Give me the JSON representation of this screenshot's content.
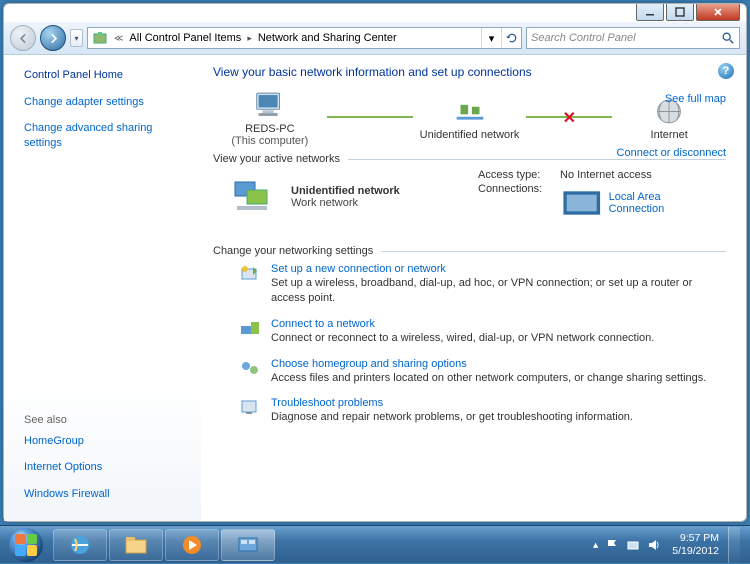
{
  "breadcrumb": {
    "prev": "All Control Panel Items",
    "current": "Network and Sharing Center"
  },
  "search": {
    "placeholder": "Search Control Panel"
  },
  "sidebar": {
    "home": "Control Panel Home",
    "links": [
      "Change adapter settings",
      "Change advanced sharing settings"
    ],
    "see_also_label": "See also",
    "see_also": [
      "HomeGroup",
      "Internet Options",
      "Windows Firewall"
    ]
  },
  "main": {
    "heading": "View your basic network information and set up connections",
    "full_map": "See full map",
    "nodes": {
      "pc": "REDS-PC",
      "pc_sub": "(This computer)",
      "net": "Unidentified network",
      "internet": "Internet"
    },
    "sect_active": "View your active networks",
    "connect_link": "Connect or disconnect",
    "netbox": {
      "name": "Unidentified network",
      "type": "Work network",
      "access_k": "Access type:",
      "access_v": "No Internet access",
      "conn_k": "Connections:",
      "conn_v": "Local Area Connection"
    },
    "sect_change": "Change your networking settings",
    "options": [
      {
        "title": "Set up a new connection or network",
        "desc": "Set up a wireless, broadband, dial-up, ad hoc, or VPN connection; or set up a router or access point."
      },
      {
        "title": "Connect to a network",
        "desc": "Connect or reconnect to a wireless, wired, dial-up, or VPN network connection."
      },
      {
        "title": "Choose homegroup and sharing options",
        "desc": "Access files and printers located on other network computers, or change sharing settings."
      },
      {
        "title": "Troubleshoot problems",
        "desc": "Diagnose and repair network problems, or get troubleshooting information."
      }
    ]
  },
  "clock": {
    "time": "9:57 PM",
    "date": "5/19/2012"
  }
}
